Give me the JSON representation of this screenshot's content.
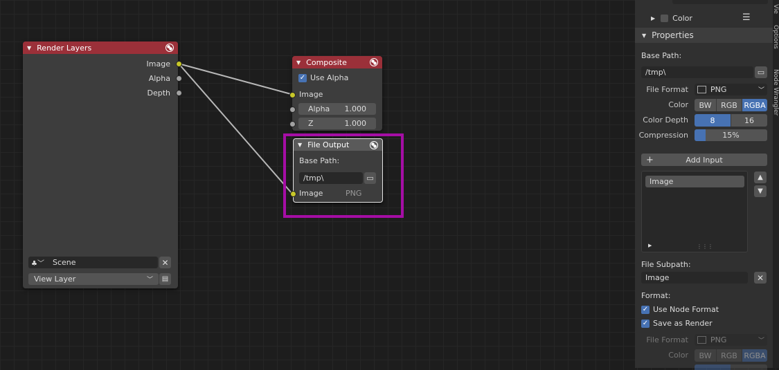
{
  "render_layers": {
    "title": "Render Layers",
    "outputs": [
      "Image",
      "Alpha",
      "Depth"
    ],
    "scene": "Scene",
    "view_layer": "View Layer"
  },
  "composite": {
    "title": "Composite",
    "use_alpha": "Use Alpha",
    "image": "Image",
    "alpha_label": "Alpha",
    "alpha_value": "1.000",
    "z_label": "Z",
    "z_value": "1.000"
  },
  "file_output": {
    "title": "File Output",
    "base_path_label": "Base Path:",
    "base_path": "/tmp\\",
    "input_label": "Image",
    "input_format": "PNG"
  },
  "highlight_color": "#a50ea5",
  "sidebar": {
    "color_label": "Color",
    "properties_title": "Properties",
    "base_path_label": "Base Path:",
    "base_path": "/tmp\\",
    "file_format_label": "File Format",
    "file_format": "PNG",
    "color_modes": [
      "BW",
      "RGB",
      "RGBA"
    ],
    "color_depth_label": "Color Depth",
    "color_depths": [
      "8",
      "16"
    ],
    "compression_label": "Compression",
    "compression": "15%",
    "add_input": "Add Input",
    "inputs": [
      "Image"
    ],
    "file_subpath_label": "File Subpath:",
    "file_subpath": "Image",
    "format_label": "Format:",
    "use_node_format": "Use Node Format",
    "save_as_render": "Save as Render",
    "tabs": [
      "Vie",
      "Options",
      "Node Wrangler"
    ]
  }
}
